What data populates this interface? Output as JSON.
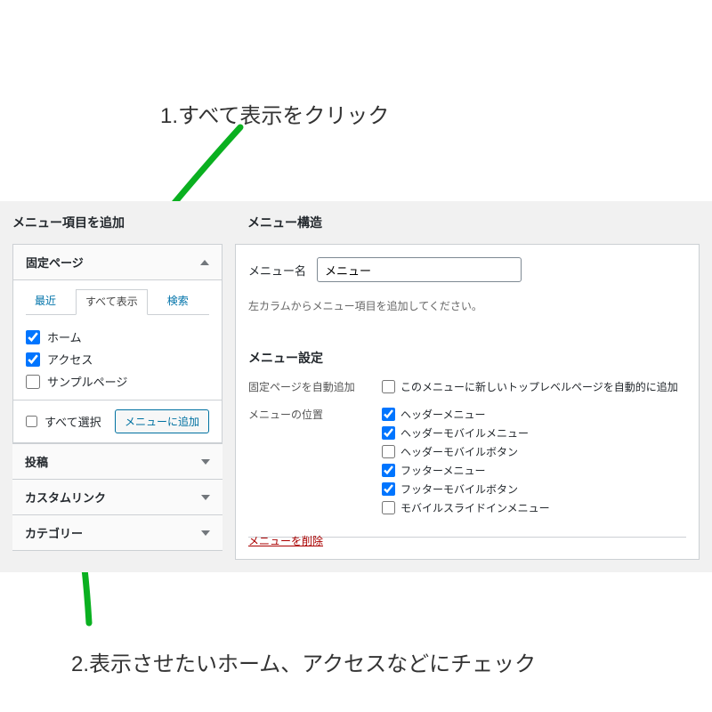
{
  "annotations": {
    "step1": "1.すべて表示をクリック",
    "step2": "2.表示させたいホーム、アクセスなどにチェック"
  },
  "left": {
    "title": "メニュー項目を追加",
    "panel_title": "固定ページ",
    "tabs": {
      "recent": "最近",
      "all": "すべて表示",
      "search": "検索"
    },
    "pages": [
      {
        "label": "ホーム",
        "checked": true
      },
      {
        "label": "アクセス",
        "checked": true
      },
      {
        "label": "サンプルページ",
        "checked": false
      }
    ],
    "select_all": "すべて選択",
    "add_button": "メニューに追加",
    "collapsed": [
      "投稿",
      "カスタムリンク",
      "カテゴリー"
    ]
  },
  "right": {
    "title": "メニュー構造",
    "menu_name_label": "メニュー名",
    "menu_name_value": "メニュー",
    "instruction": "左カラムからメニュー項目を追加してください。",
    "settings_title": "メニュー設定",
    "auto_add_label": "固定ページを自動追加",
    "auto_add_checkbox": "このメニューに新しいトップレベルページを自動的に追加",
    "position_label": "メニューの位置",
    "positions": [
      {
        "label": "ヘッダーメニュー",
        "checked": true
      },
      {
        "label": "ヘッダーモバイルメニュー",
        "checked": true
      },
      {
        "label": "ヘッダーモバイルボタン",
        "checked": false
      },
      {
        "label": "フッターメニュー",
        "checked": true
      },
      {
        "label": "フッターモバイルボタン",
        "checked": true
      },
      {
        "label": "モバイルスライドインメニュー",
        "checked": false
      }
    ],
    "delete": "メニューを削除"
  }
}
